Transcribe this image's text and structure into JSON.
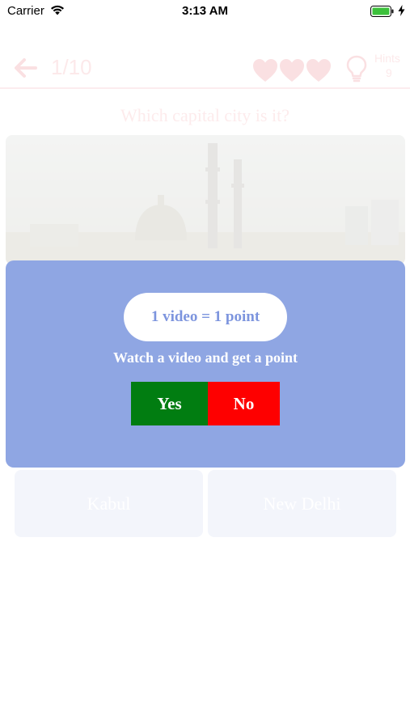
{
  "status_bar": {
    "carrier": "Carrier",
    "time": "3:13 AM",
    "icons": [
      "wifi-icon",
      "battery-icon",
      "charging-bolt-icon"
    ]
  },
  "header": {
    "back_icon": "arrow-left-icon",
    "progress": "1/10",
    "lives_icon": "heart-icon",
    "lives": 3,
    "hint_icon": "lightbulb-icon",
    "hints_label": "Hints",
    "hints_count": "9"
  },
  "question": "Which capital city is it?",
  "answers": [
    "Kabul",
    "New Delhi"
  ],
  "popup": {
    "offer": "1 video = 1 point",
    "message": "Watch a video and get a point",
    "yes_label": "Yes",
    "no_label": "No"
  },
  "colors": {
    "popup_bg": "#8fa6e3",
    "yes": "#017d11",
    "no": "#fe0000",
    "accent_pink": "#f19aa0"
  }
}
